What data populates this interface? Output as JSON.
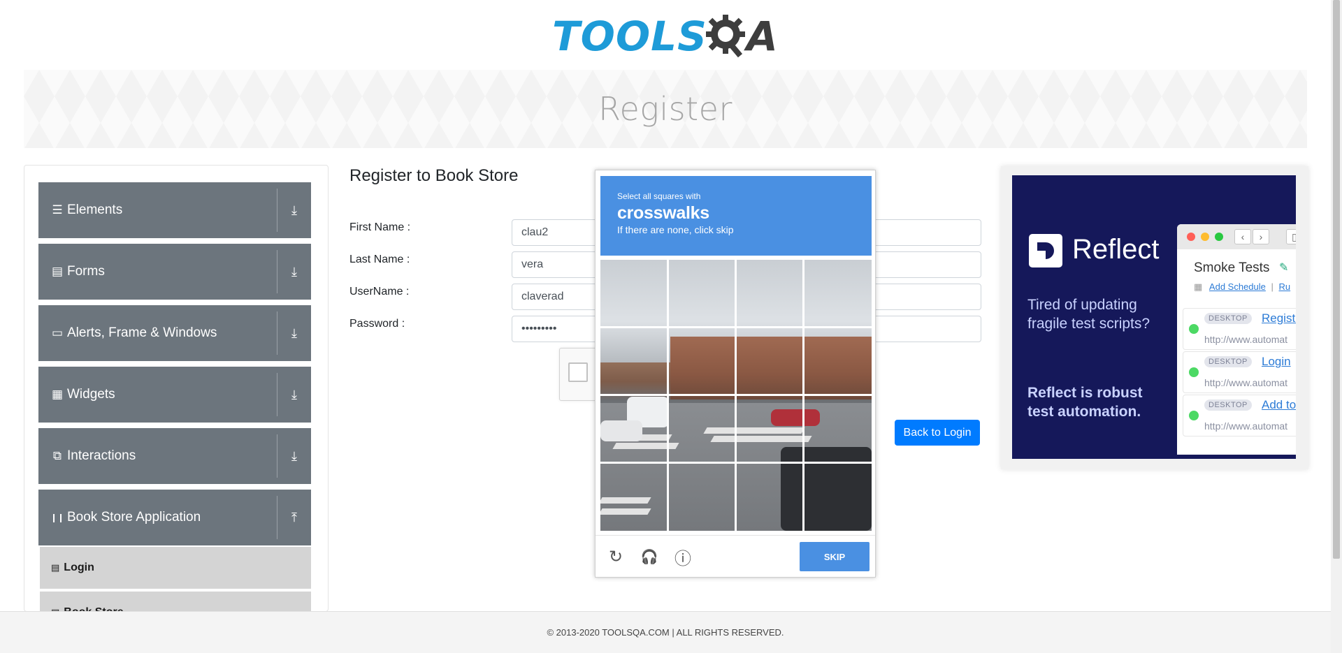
{
  "logo": {
    "part1": "TOOLS",
    "part2": "QA"
  },
  "page_title": "Register",
  "sidebar": {
    "groups": [
      {
        "label": "Elements",
        "icon": "hamburger-icon",
        "glyph": "☰",
        "arrow": "⤓"
      },
      {
        "label": "Forms",
        "icon": "document-icon",
        "glyph": "▤",
        "arrow": "⤓"
      },
      {
        "label": "Alerts, Frame & Windows",
        "icon": "window-icon",
        "glyph": "▭",
        "arrow": "⤓"
      },
      {
        "label": "Widgets",
        "icon": "widgets-icon",
        "glyph": "▦",
        "arrow": "⤓"
      },
      {
        "label": "Interactions",
        "icon": "interaction-icon",
        "glyph": "⧉",
        "arrow": "⤓"
      },
      {
        "label": "Book Store Application",
        "icon": "books-icon",
        "glyph": "❙❙",
        "arrow": "⤒"
      }
    ],
    "items": [
      {
        "label": "Login",
        "glyph": "▤"
      },
      {
        "label": "Book Store",
        "glyph": "▤"
      }
    ]
  },
  "form": {
    "title": "Register to Book Store",
    "first_name_label": "First Name :",
    "first_name_value": "clau2",
    "last_name_label": "Last Name :",
    "last_name_value": "vera",
    "username_label": "UserName :",
    "username_value": "claverad",
    "password_label": "Password :",
    "password_value": "•••••••••",
    "back_to_login": "Back to Login"
  },
  "captcha": {
    "instruction": "Select all squares with",
    "target": "crosswalks",
    "hint": "If there are none, click skip",
    "skip": "SKIP",
    "reload_glyph": "↻",
    "audio_glyph": "🎧",
    "info_glyph": "ⓘ"
  },
  "ad": {
    "brand": "Reflect",
    "tagline": "Tired of updating fragile test scripts?",
    "strong": "Reflect is robust test automation.",
    "window_title": "Smoke Tests",
    "schedule_link": "Add Schedule",
    "schedule_sep": "|",
    "schedule_more": "Ru",
    "rows": [
      {
        "tag": "DESKTOP",
        "name": "Registr",
        "url": "http://www.automat"
      },
      {
        "tag": "DESKTOP",
        "name": "Login",
        "url": "http://www.automat"
      },
      {
        "tag": "DESKTOP",
        "name": "Add to",
        "url": "http://www.automat"
      }
    ],
    "colors": {
      "background": "#15185a",
      "text": "#c9d2ff",
      "accent": "#4cd964"
    }
  },
  "footer": {
    "text": "© 2013-2020 TOOLSQA.COM | ALL RIGHTS RESERVED."
  },
  "colors": {
    "primary": "#007bff",
    "sidebar": "#6c757d",
    "captcha_blue": "#4a90e2",
    "logo_blue": "#1e9bd8"
  }
}
